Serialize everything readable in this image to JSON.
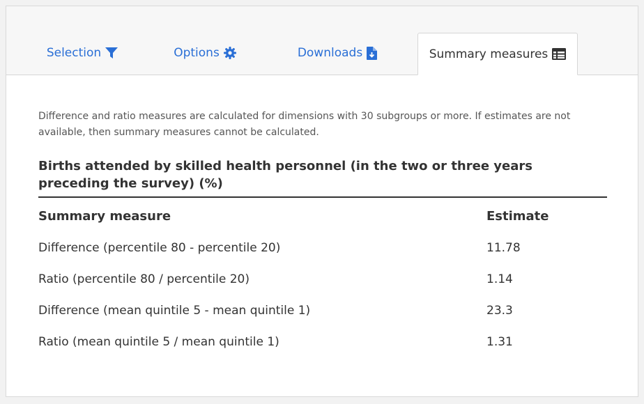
{
  "tabs": [
    {
      "label": "Selection",
      "icon": "filter-icon"
    },
    {
      "label": "Options",
      "icon": "gear-icon"
    },
    {
      "label": "Downloads",
      "icon": "file-download-icon"
    },
    {
      "label": "Summary measures",
      "icon": "table-icon",
      "active": true
    }
  ],
  "colors": {
    "link": "#2a6fd6",
    "text": "#333333"
  },
  "summary": {
    "note": "Difference and ratio measures are calculated for dimensions with 30 subgroups or more. If estimates are not available, then summary measures cannot be calculated.",
    "title": "Births attended by skilled health personnel (in the two or three years preceding the survey) (%)",
    "headers": {
      "measure": "Summary measure",
      "estimate": "Estimate"
    },
    "rows": [
      {
        "measure": "Difference (percentile 80 - percentile 20)",
        "estimate": "11.78"
      },
      {
        "measure": "Ratio (percentile 80 / percentile 20)",
        "estimate": "1.14"
      },
      {
        "measure": "Difference (mean quintile 5 - mean quintile 1)",
        "estimate": "23.3"
      },
      {
        "measure": "Ratio (mean quintile 5 / mean quintile 1)",
        "estimate": "1.31"
      }
    ]
  }
}
